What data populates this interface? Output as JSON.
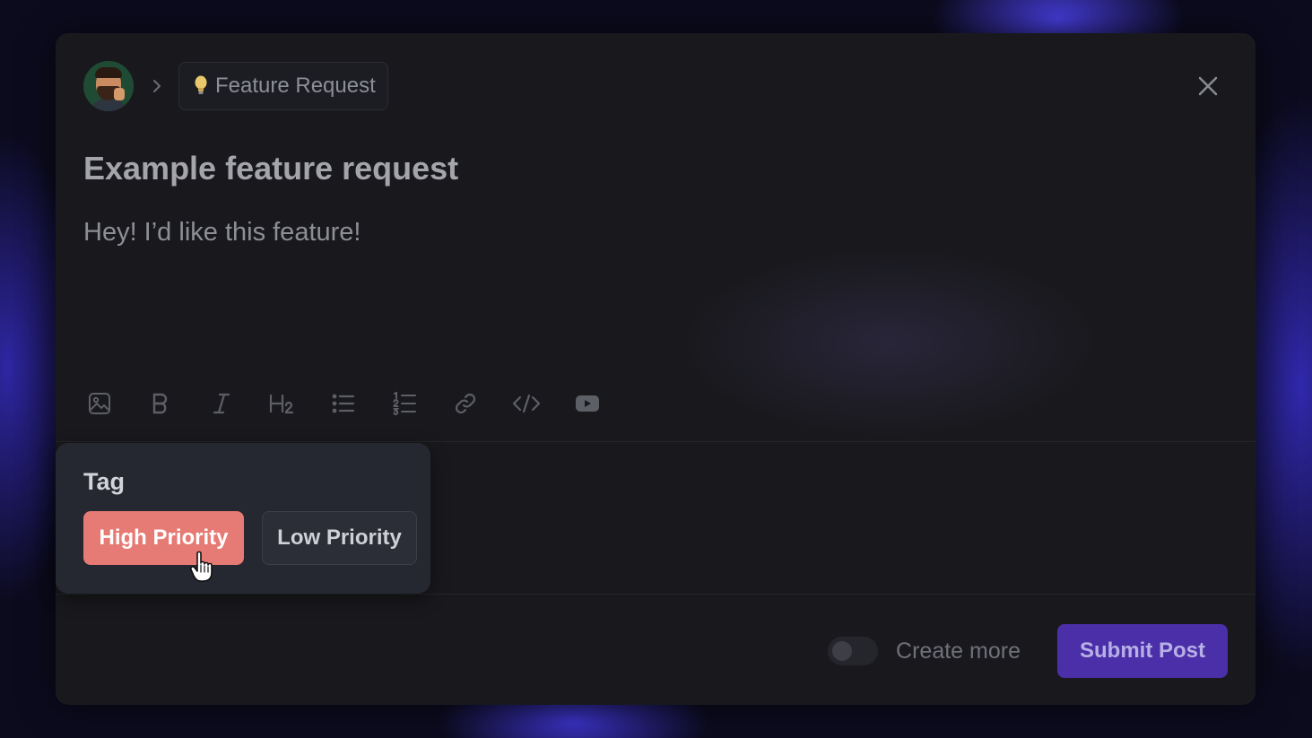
{
  "header": {
    "breadcrumb_separator_icon": "chevron-right-icon",
    "category": {
      "icon": "lightbulb-icon",
      "label": "Feature Request"
    },
    "close_icon": "close-icon"
  },
  "post": {
    "title": "Example feature request",
    "body": "Hey! I’d like this feature!"
  },
  "toolbar": {
    "tools": [
      "image-icon",
      "bold-icon",
      "italic-icon",
      "heading-2-icon",
      "bulleted-list-icon",
      "numbered-list-icon",
      "link-icon",
      "code-icon",
      "youtube-embed-icon"
    ]
  },
  "tag_popover": {
    "title": "Tag",
    "options": [
      {
        "label": "High Priority",
        "color": "#e67a74"
      },
      {
        "label": "Low Priority",
        "color": "#2b2d37"
      }
    ]
  },
  "footer": {
    "create_more_label": "Create more",
    "create_more_enabled": false,
    "submit_label": "Submit Post",
    "submit_color": "#4a2fa8"
  }
}
